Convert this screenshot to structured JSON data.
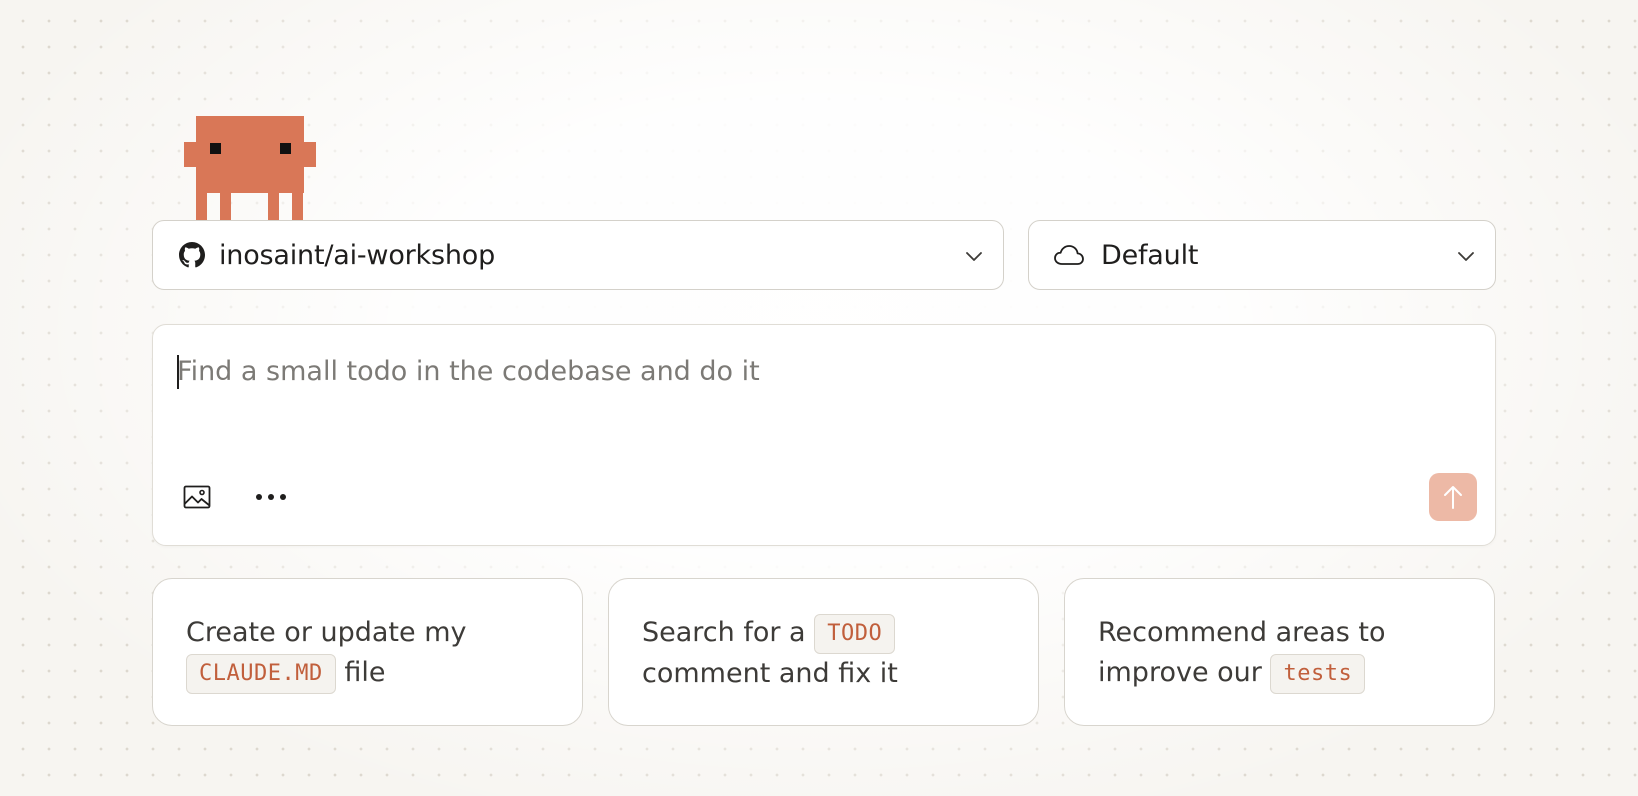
{
  "repo_selector": {
    "icon": "github-icon",
    "value": "inosaint/ai-workshop"
  },
  "environment_selector": {
    "icon": "cloud-icon",
    "value": "Default"
  },
  "prompt": {
    "placeholder": "Find a small todo in the codebase and do it",
    "value": ""
  },
  "toolbar": {
    "image_icon": "image-icon",
    "more_icon": "more-icon",
    "send_icon": "arrow-up-icon"
  },
  "suggestions": [
    {
      "before": "Create or update my",
      "code": "CLAUDE.MD",
      "after": "file"
    },
    {
      "before": "Search for a",
      "code": "TODO",
      "after": "comment and fix it"
    },
    {
      "before": "Recommend areas to improve our",
      "code": "tests",
      "after": ""
    }
  ],
  "colors": {
    "accent": "#d97757",
    "send_button_disabled": "#edb9a6",
    "code_text": "#c15f3c"
  }
}
